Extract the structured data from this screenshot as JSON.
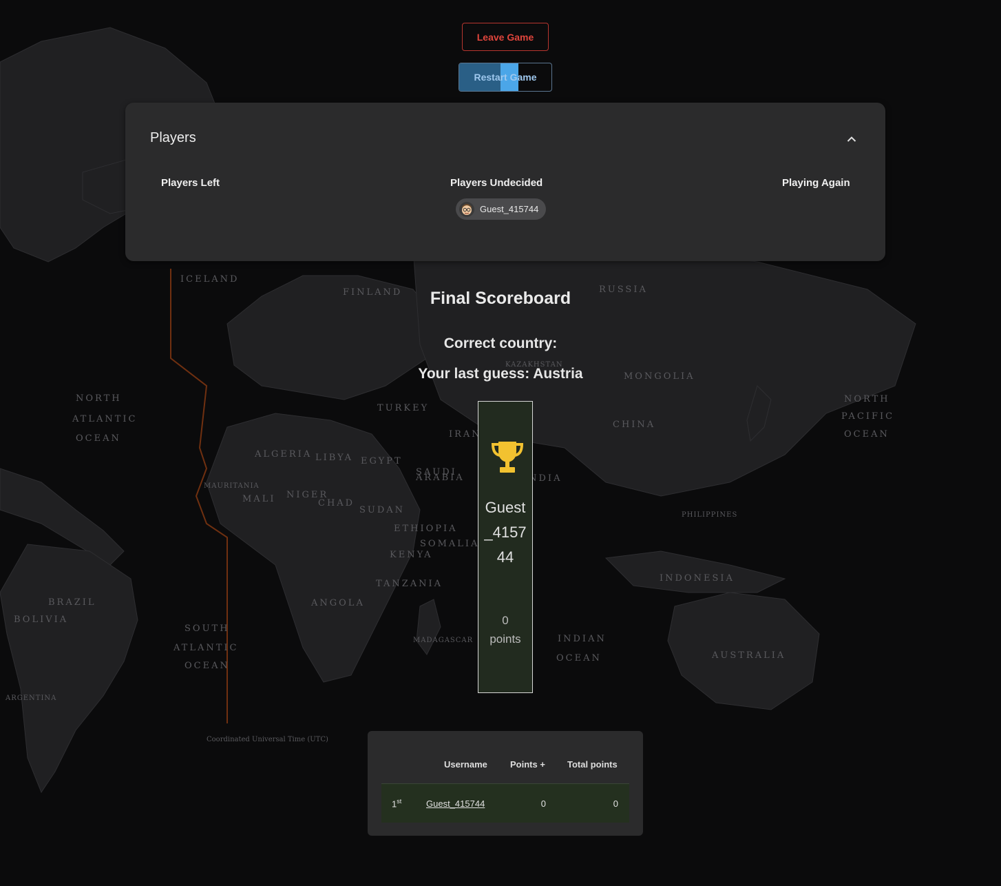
{
  "map_labels": [
    "RUSSIA",
    "MONGOLIA",
    "CHINA",
    "INDIA",
    "NORTH",
    "ATLANTIC",
    "OCEAN",
    "BRAZIL",
    "SOUTH",
    "ATLANTIC",
    "OCEAN",
    "ALGERIA",
    "LIBYA",
    "EGYPT",
    "SAUDI",
    "ARABIA",
    "SUDAN",
    "ETHIOPIA",
    "NIGER",
    "CHAD",
    "MALI",
    "ANGOLA",
    "TANZANIA",
    "KENYA",
    "NORTH",
    "PACIFIC",
    "OCEAN",
    "INDONESIA",
    "AUSTRALIA",
    "PHILIPPINES",
    "IRAN",
    "TURKEY",
    "FINLAND",
    "ICELAND",
    "KAZAKHSTAN",
    "MAURITANIA",
    "INDIAN",
    "OCEAN",
    "ARGENTINA",
    "BOLIVIA",
    "SOMALIA",
    "MADAGASCAR",
    "Coordinated Universal Time (UTC)"
  ],
  "toolbar": {
    "leave_label": "Leave Game",
    "restart_label": "Restart Game",
    "restart_progress": 0.63
  },
  "players": {
    "title": "Players",
    "left_heading": "Players Left",
    "undecided_heading": "Players Undecided",
    "again_heading": "Playing Again",
    "undecided": [
      "Guest_415744"
    ]
  },
  "scoreboard": {
    "title": "Final Scoreboard",
    "correct_country": "Correct country:",
    "last_guess": "Your last guess: Austria",
    "winner_name": "Guest_415744",
    "winner_points": "0",
    "winner_points_label": "points",
    "headers": {
      "username": "Username",
      "points_plus": "Points +",
      "total": "Total points"
    },
    "rows": [
      {
        "rank": "1",
        "rank_suffix": "st",
        "username": "Guest_415744",
        "points_plus": "0",
        "total": "0"
      }
    ]
  },
  "colors": {
    "leave": "#e0453c",
    "restart": "#9fc8ee",
    "panel": "#2b2b2c",
    "trophy": "#f2c230",
    "winner_bg": "#222b1f"
  },
  "icons": {
    "collapse": "chevron-up-icon",
    "winner": "trophy-icon",
    "avatar": "avatar-icon"
  }
}
